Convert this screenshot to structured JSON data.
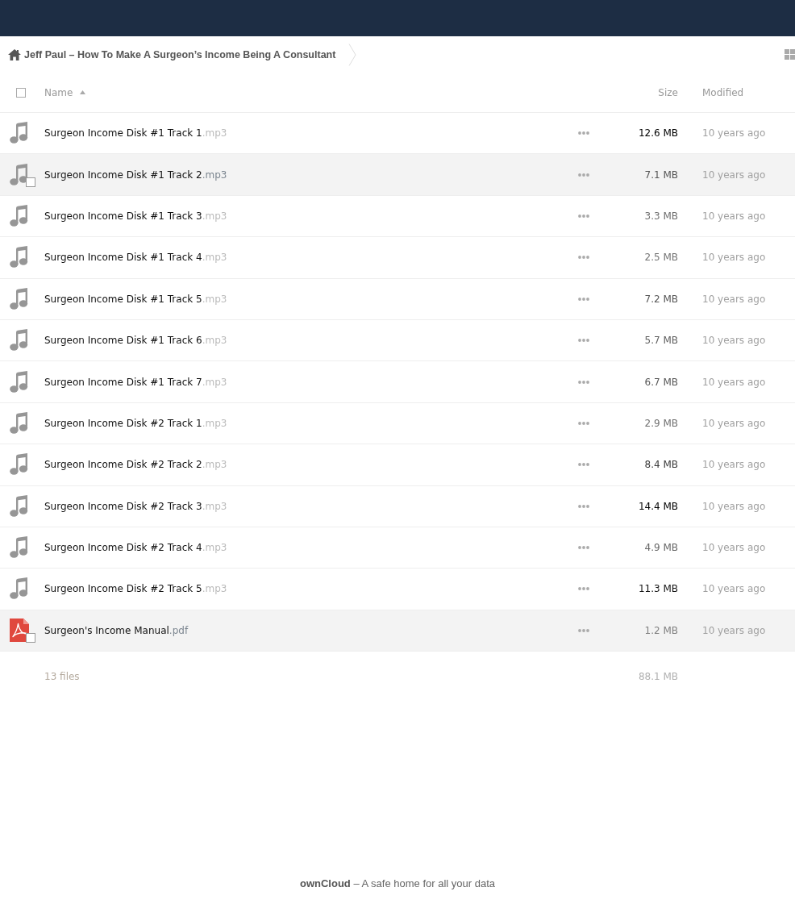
{
  "breadcrumb": {
    "crumbs": [
      {
        "label": "Jeff Paul – How To Make A Surgeon’s Income Being A Consultant",
        "home": true
      }
    ]
  },
  "table": {
    "select_all": {
      "checked": false
    },
    "columns": [
      {
        "label": "Name",
        "sorted": true
      },
      {
        "label": "Size",
        "sorted": false
      },
      {
        "label": "Modified",
        "sorted": false
      }
    ],
    "rows": [
      {
        "name": "Surgeon Income Disk #1 Track 1.mp3",
        "kind": "audio",
        "highlighted": false,
        "checked": false,
        "size": "12.6 MB",
        "color": "#000000",
        "modified": "10 years ago"
      },
      {
        "name": "Surgeon Income Disk #1 Track 2.mp3",
        "kind": "audio",
        "highlighted": true,
        "checked": false,
        "size": "7.1 MB",
        "color": "#555555",
        "modified": "10 years ago"
      },
      {
        "name": "Surgeon Income Disk #1 Track 3.mp3",
        "kind": "audio",
        "highlighted": false,
        "checked": false,
        "size": "3.3 MB",
        "color": "#6e6e6e",
        "modified": "10 years ago"
      },
      {
        "name": "Surgeon Income Disk #1 Track 4.mp3",
        "kind": "audio",
        "highlighted": false,
        "checked": false,
        "size": "2.5 MB",
        "color": "#747474",
        "modified": "10 years ago"
      },
      {
        "name": "Surgeon Income Disk #1 Track 5.mp3",
        "kind": "audio",
        "highlighted": false,
        "checked": false,
        "size": "7.2 MB",
        "color": "#555555",
        "modified": "10 years ago"
      },
      {
        "name": "Surgeon Income Disk #1 Track 6.mp3",
        "kind": "audio",
        "highlighted": false,
        "checked": false,
        "size": "5.7 MB",
        "color": "#606060",
        "modified": "10 years ago"
      },
      {
        "name": "Surgeon Income Disk #1 Track 7.mp3",
        "kind": "audio",
        "highlighted": false,
        "checked": false,
        "size": "6.7 MB",
        "color": "#585858",
        "modified": "10 years ago"
      },
      {
        "name": "Surgeon Income Disk #2 Track 1.mp3",
        "kind": "audio",
        "highlighted": false,
        "checked": false,
        "size": "2.9 MB",
        "color": "#707070",
        "modified": "10 years ago"
      },
      {
        "name": "Surgeon Income Disk #2 Track 2.mp3",
        "kind": "audio",
        "highlighted": false,
        "checked": false,
        "size": "8.4 MB",
        "color": "#3a3a3a",
        "modified": "10 years ago"
      },
      {
        "name": "Surgeon Income Disk #2 Track 3.mp3",
        "kind": "audio",
        "highlighted": false,
        "checked": false,
        "size": "14.4 MB",
        "color": "#000000",
        "modified": "10 years ago"
      },
      {
        "name": "Surgeon Income Disk #2 Track 4.mp3",
        "kind": "audio",
        "highlighted": false,
        "checked": false,
        "size": "4.9 MB",
        "color": "#666666",
        "modified": "10 years ago"
      },
      {
        "name": "Surgeon Income Disk #2 Track 5.mp3",
        "kind": "audio",
        "highlighted": false,
        "checked": false,
        "size": "11.3 MB",
        "color": "#141414",
        "modified": "10 years ago"
      },
      {
        "name": "Surgeon's Income Manual.pdf",
        "kind": "pdf",
        "highlighted": true,
        "checked": false,
        "size": "1.2 MB",
        "color": "#808080",
        "modified": "10 years ago"
      }
    ],
    "summary": {
      "files": "13 files",
      "size": "88.1 MB"
    }
  },
  "footer": {
    "text": "**ownCloud** – A safe home for all your data"
  }
}
